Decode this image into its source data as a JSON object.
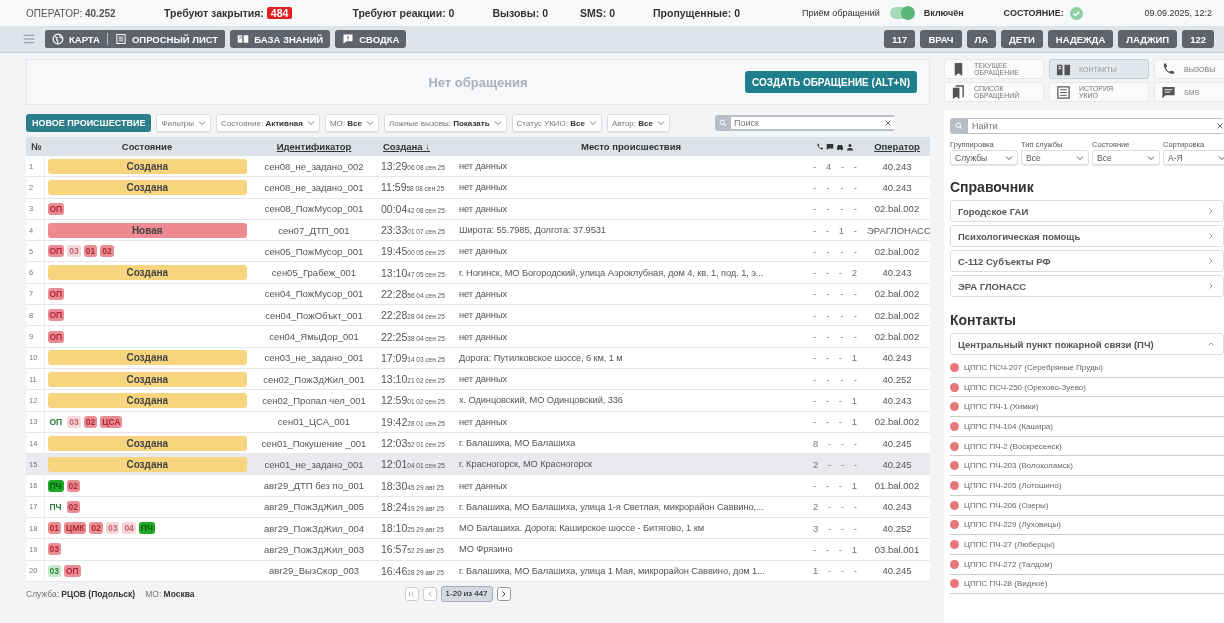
{
  "top_bar": {
    "operator": "ОПЕРАТОР: **40.252**",
    "closing_label": "Требуют закрытия:",
    "closing_count": "484",
    "stats": [
      "Требуют реакции: 0",
      "Вызовы: 0",
      "SMS: 0",
      "Пропущенные: 0"
    ],
    "intake_label": "Приём обращений",
    "intake_on": true,
    "intake_state": "Включён",
    "status_label": "СОСТОЯНИЕ:",
    "datetime": "09.09.2025, 12:2"
  },
  "toolbar": {
    "left_buttons": [
      {
        "kind": "map",
        "label": "КАРТА"
      },
      {
        "kind": "survey",
        "label": "ОПРОСНЫЙ ЛИСТ"
      },
      {
        "kind": "kb",
        "label": "БАЗА ЗНАНИЙ"
      },
      {
        "kind": "summary",
        "label": "СВОДКА"
      }
    ],
    "right_buttons": [
      "117",
      "ВРАЧ",
      "ЛА",
      "ДЕТИ",
      "НАДЕЖДА",
      "ЛАДЖИП",
      "122"
    ]
  },
  "current": {
    "empty_text": "Нет обращения",
    "create_button": "СОЗДАТЬ ОБРАЩЕНИЕ (ALT+N)"
  },
  "filters": {
    "new_button": "НОВОЕ ПРОИСШЕСТВИЕ",
    "chips": [
      "Фильтры",
      "Состояние: **Активная**",
      "МО: **Все**",
      "Ложные вызовы: **Показать**",
      "Статус УКИО: **Все**",
      "Автор: **Все**"
    ],
    "search_placeholder": "Поиск"
  },
  "table": {
    "columns": [
      "№",
      "Состояние",
      "Идентификатор",
      "Создана ↓",
      "Место происшествия",
      "Оператор"
    ],
    "rows": [
      {
        "n": "1",
        "status": {
          "kind": "created",
          "label": "Создана"
        },
        "id": "сен08_не_задано_002",
        "time": "13:29",
        "time_small": "06 08 сен 25",
        "place": "нет данных",
        "counts": [
          "-",
          "4",
          "-",
          "-"
        ],
        "operator": "40.243",
        "selected": false
      },
      {
        "n": "2",
        "status": {
          "kind": "created",
          "label": "Создана"
        },
        "id": "сен08_не_задано_001",
        "time": "11:59",
        "time_small": "58 08 сен 25",
        "place": "нет данных",
        "counts": [
          "-",
          "-",
          "-",
          "-"
        ],
        "operator": "40.243",
        "selected": false
      },
      {
        "n": "3",
        "tags": [
          {
            "kind": "alert",
            "label": "ОП"
          }
        ],
        "id": "сен08_ПожМусор_001",
        "time": "00:04",
        "time_small": "42 08 сен 25",
        "place": "нет данных",
        "counts": [
          "-",
          "-",
          "-",
          "-"
        ],
        "operator": "02.bal.002",
        "selected": false
      },
      {
        "n": "4",
        "status": {
          "kind": "new",
          "label": "Новая"
        },
        "id": "сен07_ДТП_001",
        "time": "23:33",
        "time_small": "01 07 сен 25",
        "place": "Широта: 55.7985, Долгота: 37.9531",
        "counts": [
          "-",
          "-",
          "1",
          "-"
        ],
        "operator": "ЭРАГЛОНАСС",
        "selected": false
      },
      {
        "n": "5",
        "tags": [
          {
            "kind": "alert",
            "label": "ОП"
          },
          {
            "kind": "muted",
            "label": "03"
          },
          {
            "kind": "alert",
            "label": "01"
          },
          {
            "kind": "alert",
            "label": "02"
          }
        ],
        "id": "сен05_ПожМусор_001",
        "time": "19:45",
        "time_small": "00 05 сен 25",
        "place": "нет данных",
        "counts": [
          "-",
          "-",
          "-",
          "-"
        ],
        "operator": "02.bal.002",
        "selected": false
      },
      {
        "n": "6",
        "status": {
          "kind": "created",
          "label": "Создана"
        },
        "id": "сен05_Грабеж_001",
        "time": "13:10",
        "time_small": "47 05 сен 25",
        "place": "г. Ногинск, МО Богородский, улица Аэроклубная, дом 4, кв. 1, под. 1, э...",
        "counts": [
          "-",
          "-",
          "-",
          "2"
        ],
        "operator": "40.243",
        "selected": false
      },
      {
        "n": "7",
        "tags": [
          {
            "kind": "alert",
            "label": "ОП"
          }
        ],
        "id": "сен04_ПожМусор_001",
        "time": "22:28",
        "time_small": "56 04 сен 25",
        "place": "нет данных",
        "counts": [
          "-",
          "-",
          "-",
          "-"
        ],
        "operator": "02.bal.002",
        "selected": false
      },
      {
        "n": "8",
        "tags": [
          {
            "kind": "alert",
            "label": "ОП"
          }
        ],
        "id": "сен04_ПожОбъкт_001",
        "time": "22:28",
        "time_small": "28 04 сен 25",
        "place": "нет данных",
        "counts": [
          "-",
          "-",
          "-",
          "-"
        ],
        "operator": "02.bal.002",
        "selected": false
      },
      {
        "n": "9",
        "tags": [
          {
            "kind": "alert",
            "label": "ОП"
          }
        ],
        "id": "сен04_ЯмыДор_001",
        "time": "22:25",
        "time_small": "38 04 сен 25",
        "place": "нет данных",
        "counts": [
          "-",
          "-",
          "-",
          "-"
        ],
        "operator": "02.bal.002",
        "selected": false
      },
      {
        "n": "10",
        "status": {
          "kind": "created",
          "label": "Создана"
        },
        "id": "сен03_не_задано_001",
        "time": "17:09",
        "time_small": "14 03 сен 25",
        "place": "Дорога: Путилковское шоссе, 6 км, 1 м",
        "counts": [
          "-",
          "-",
          "-",
          "1"
        ],
        "operator": "40.243",
        "selected": false
      },
      {
        "n": "11",
        "status": {
          "kind": "created",
          "label": "Создана"
        },
        "id": "сен02_ПожЗдЖил_001",
        "time": "13:10",
        "time_small": "21 02 сен 25",
        "place": "нет данных",
        "counts": [
          "-",
          "-",
          "-",
          "-"
        ],
        "operator": "40.252",
        "selected": false
      },
      {
        "n": "12",
        "status": {
          "kind": "created",
          "label": "Создана"
        },
        "id": "сен02_Пропал чел_001",
        "time": "12:59",
        "time_small": "01 02 сен 25",
        "place": "х. Одинцовский, МО Одинцовский, 336",
        "counts": [
          "-",
          "-",
          "-",
          "1"
        ],
        "operator": "40.243",
        "selected": false
      },
      {
        "n": "13",
        "tags": [
          {
            "kind": "plain",
            "label": "ОП"
          },
          {
            "kind": "muted",
            "label": "03"
          },
          {
            "kind": "alert",
            "label": "02"
          },
          {
            "kind": "alert",
            "label": "ЦСА"
          }
        ],
        "id": "сен01_ЦСА_001",
        "time": "19:42",
        "time_small": "28 01 сен 25",
        "place": "нет данных",
        "counts": [
          "-",
          "-",
          "-",
          "1"
        ],
        "operator": "02.bal.002",
        "selected": false
      },
      {
        "n": "14",
        "status": {
          "kind": "created",
          "label": "Создана"
        },
        "id": "сен01_Покушение _001",
        "time": "12:03",
        "time_small": "52 01 сен 25",
        "place": "г. Балашиха, МО Балашиха",
        "counts": [
          "8",
          "-",
          "-",
          "-"
        ],
        "operator": "40.245",
        "selected": false
      },
      {
        "n": "15",
        "status": {
          "kind": "created",
          "label": "Создана"
        },
        "id": "сен01_не_задано_001",
        "time": "12:01",
        "time_small": "04 01 сен 25",
        "place": "г. Красногорск, МО Красногорск",
        "counts": [
          "2",
          "-",
          "-",
          "-"
        ],
        "operator": "40.245",
        "selected": true
      },
      {
        "n": "16",
        "tags": [
          {
            "kind": "ok",
            "label": "ПЧ"
          },
          {
            "kind": "alert",
            "label": "02"
          }
        ],
        "id": "авг29_ДТП без по_001",
        "time": "18:30",
        "time_small": "45 29 авг 25",
        "place": "нет данных",
        "counts": [
          "-",
          "-",
          "-",
          "1"
        ],
        "operator": "01.bal.002",
        "selected": false
      },
      {
        "n": "17",
        "tags": [
          {
            "kind": "plain",
            "label": "ПЧ"
          },
          {
            "kind": "alert",
            "label": "02"
          }
        ],
        "id": "авг29_ПожЗдЖил_005",
        "time": "18:24",
        "time_small": "19 29 авг 25",
        "place": "г. Балашиха, МО Балашиха, улица 1-я Светлая, микрорайон Саввино,...",
        "counts": [
          "2",
          "-",
          "-",
          "-"
        ],
        "operator": "40.243",
        "selected": false
      },
      {
        "n": "18",
        "tags": [
          {
            "kind": "alert",
            "label": "01"
          },
          {
            "kind": "alert",
            "label": "ЦМК"
          },
          {
            "kind": "alert",
            "label": "02"
          },
          {
            "kind": "muted",
            "label": "03"
          },
          {
            "kind": "muted",
            "label": "04"
          },
          {
            "kind": "ok",
            "label": "ПЧ"
          }
        ],
        "id": "авг29_ПожЗдЖил_004",
        "time": "18:10",
        "time_small": "25 29 авг 25",
        "place": "МО Балашиха. Дорога: Каширское шоссе - Битягово, 1 км",
        "counts": [
          "3",
          "-",
          "-",
          "-"
        ],
        "operator": "40.252",
        "selected": false
      },
      {
        "n": "19",
        "tags": [
          {
            "kind": "alert",
            "label": "03"
          }
        ],
        "id": "авг29_ПожЗдЖил_003",
        "time": "16:57",
        "time_small": "52 29 авг 25",
        "place": "МО Фрязино",
        "counts": [
          "-",
          "-",
          "-",
          "1"
        ],
        "operator": "03.bal.001",
        "selected": false
      },
      {
        "n": "20",
        "tags": [
          {
            "kind": "okpale",
            "label": "03"
          },
          {
            "kind": "alert",
            "label": "ОП"
          }
        ],
        "id": "авг29_ВызСкор_003",
        "time": "16:46",
        "time_small": "28 29 авг 25",
        "place": "г. Балашиха, МО Балашиха, улица 1 Мая, микрорайон Саввино, дом 1...",
        "counts": [
          "1",
          "-",
          "-",
          "-"
        ],
        "operator": "40.245",
        "selected": false
      }
    ]
  },
  "footer": {
    "service": "Служба: **РЦОВ (Подольск)**",
    "mo": "МО: **Москва**",
    "page": "1-20 из 447"
  },
  "side": {
    "tabs": [
      {
        "kind": "bookmark",
        "label": "ТЕКУЩЕЕ ОБРАЩЕНИЕ",
        "selected": false
      },
      {
        "kind": "book",
        "label": "КОНТАКТЫ",
        "selected": true
      },
      {
        "kind": "phone",
        "label": "ВЫЗОВЫ",
        "selected": false
      },
      {
        "kind": "bookmarks",
        "label": "СПИСОК ОБРАЩЕНИЙ",
        "selected": false
      },
      {
        "kind": "list",
        "label": "ИСТОРИЯ УКИО",
        "selected": false
      },
      {
        "kind": "chat",
        "label": "SMS",
        "selected": false
      }
    ],
    "search_placeholder": "Найти",
    "selects": [
      {
        "label": "Группировка",
        "value": "Службы"
      },
      {
        "label": "Тип службы",
        "value": "Все"
      },
      {
        "label": "Состояние",
        "value": "Все"
      },
      {
        "label": "Сортировка",
        "value": "А-Я"
      }
    ],
    "directory_title": "Справочник",
    "directory": [
      "Городское ГАИ",
      "Психологическая помощь",
      "С-112 Субъекты РФ",
      "ЭРА ГЛОНАСС"
    ],
    "contacts_title": "Контакты",
    "group": {
      "label": "Центральный пункт пожарной связи (ПЧ)",
      "expanded": true,
      "items": [
        {
          "label": "ЦППС ПСЧ-207 (Серебряные Пруды)",
          "color": "#e8777b"
        },
        {
          "label": "ЦППС ПСЧ-250 (Орехово-Зуево)",
          "color": "#e8777b"
        },
        {
          "label": "ЦППС ПЧ-1 (Химки)",
          "color": "#e8777b"
        },
        {
          "label": "ЦППС ПЧ-104 (Кашира)",
          "color": "#e8777b"
        },
        {
          "label": "ЦППС ПЧ-2 (Воскресенск)",
          "color": "#e8777b"
        },
        {
          "label": "ЦППС ПЧ-203 (Волоколамск)",
          "color": "#e8777b"
        },
        {
          "label": "ЦППС ПЧ-205 (Лотошино)",
          "color": "#e8777b"
        },
        {
          "label": "ЦППС ПЧ-206 (Озеры)",
          "color": "#e8777b"
        },
        {
          "label": "ЦППС ПЧ-229 (Луховицы)",
          "color": "#e8777b"
        },
        {
          "label": "ЦППС ПЧ-27 (Люберцы)",
          "color": "#e8777b"
        },
        {
          "label": "ЦППС ПЧ-272 (Талдом)",
          "color": "#e8777b"
        },
        {
          "label": "ЦППС ПЧ-28 (Видное)",
          "color": "#e8777b"
        }
      ]
    }
  }
}
